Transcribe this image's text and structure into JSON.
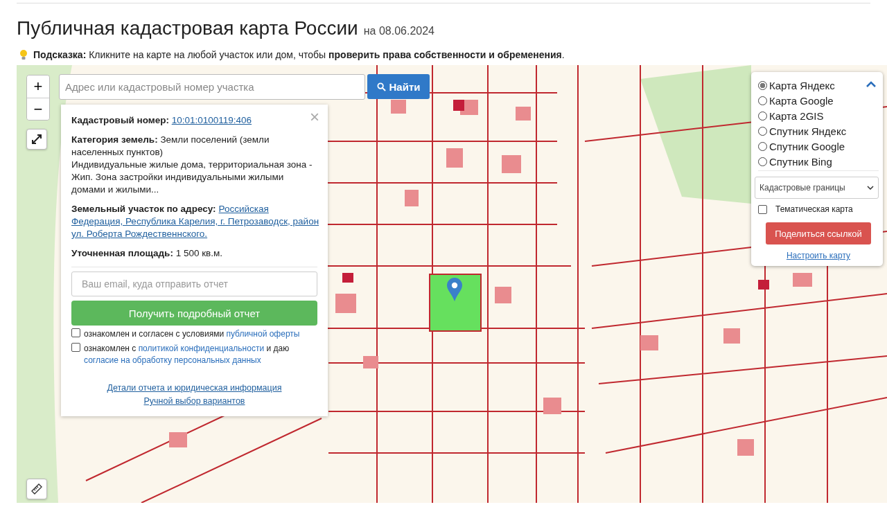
{
  "header": {
    "title": "Публичная кадастровая карта России",
    "date": "на 08.06.2024",
    "hint": "**Подсказка:** Кликните на карте на любой участок или дом, чтобы **проверить права собственности и обременения**."
  },
  "map_controls": {
    "zoom_in": "+",
    "zoom_out": "−"
  },
  "search": {
    "placeholder": "Адрес или кадастровый номер участка",
    "button": "Найти"
  },
  "popup": {
    "close": "×",
    "cadastral_label": "Кадастровый номер:",
    "cadastral_number": "10:01:0100119:406",
    "category": "**Категория земель:** Земли поселений (земли населенных пунктов)",
    "usage": "Индивидуальные жилые дома, территориальная зона - Жип. Зона застройки индивидуальными жилыми домами и жилыми...",
    "address_label": "Земельный участок по адресу:",
    "address_lines": [
      "Российская",
      "Федерация, Республика Карелия, г. Петрозаводск, район",
      "ул. Роберта Рождественнского."
    ],
    "area": "**Уточненная площадь:** 1 500 кв.м.",
    "email_placeholder": "Ваш email, куда отправить отчет",
    "report_button": "Получить подробный отчет",
    "consents": [
      {
        "checked": false,
        "parts": [
          {
            "text": "ознакомлен и согласен с условиями ",
            "link": false
          },
          {
            "text": "публичной оферты",
            "link": true
          }
        ]
      },
      {
        "checked": false,
        "parts": [
          {
            "text": "ознакомлен с ",
            "link": false
          },
          {
            "text": "политикой конфиденциальности",
            "link": true
          },
          {
            "text": " и даю ",
            "link": false
          },
          {
            "text": "согласие на обработку персональных данных",
            "link": true
          }
        ]
      }
    ],
    "links": [
      "Детали отчета и юридическая информация",
      "Ручной выбор вариантов"
    ]
  },
  "layers": {
    "expanded": true,
    "options": [
      {
        "label": "Карта Яндекс",
        "selected": true
      },
      {
        "label": "Карта Google",
        "selected": false
      },
      {
        "label": "Карта 2GIS",
        "selected": false
      },
      {
        "label": "Спутник Яндекс",
        "selected": false
      },
      {
        "label": "Спутник Google",
        "selected": false
      },
      {
        "label": "Спутник Bing",
        "selected": false
      }
    ],
    "overlay_select": "Кадастровые границы",
    "thematic": {
      "label": "Тематическая карта",
      "checked": false
    },
    "share_button": "Поделиться ссылкой",
    "settings_link": "Настроить карту"
  }
}
